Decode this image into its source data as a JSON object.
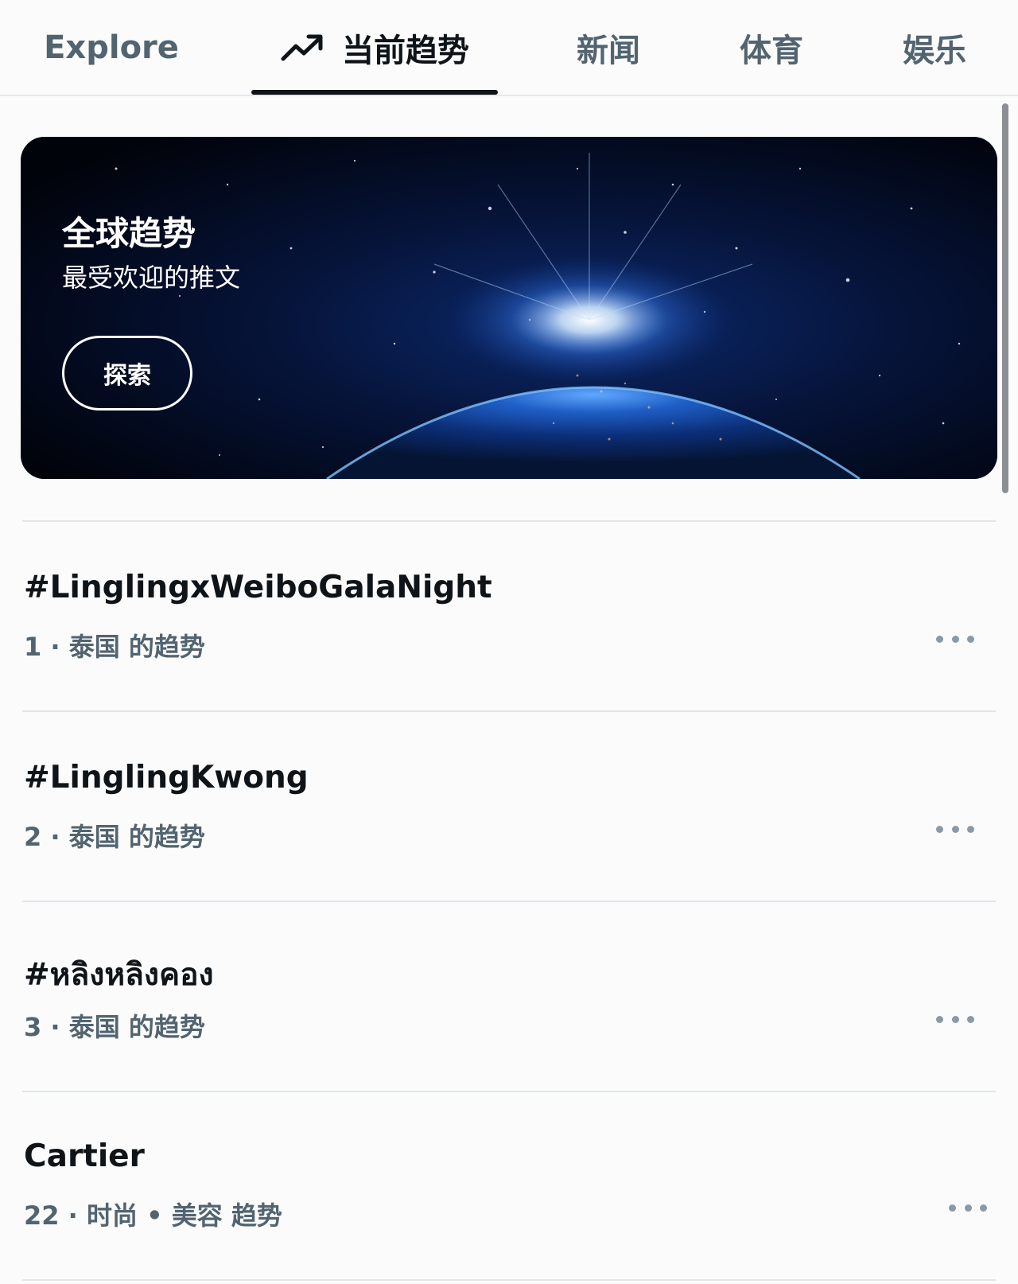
{
  "tabs": [
    {
      "label": "Explore"
    },
    {
      "label": "当前趋势",
      "icon": "trending-up-icon",
      "active": true
    },
    {
      "label": "新闻"
    },
    {
      "label": "体育"
    },
    {
      "label": "娱乐"
    }
  ],
  "hero": {
    "title": "全球趋势",
    "subtitle": "最受欢迎的推文",
    "button_label": "探索"
  },
  "trends": [
    {
      "title": "#LinglingxWeiboGalaNight",
      "meta": "1 · 泰国 的趋势"
    },
    {
      "title": "#LinglingKwong",
      "meta": "2 · 泰国 的趋势"
    },
    {
      "title": "#หลิงหลิงคอง",
      "meta": "3 · 泰国 的趋势"
    },
    {
      "title": "Cartier",
      "meta": "22 · 时尚 • 美容 趋势"
    }
  ],
  "colors": {
    "text_primary": "#0f1419",
    "text_secondary": "#536471",
    "divider": "#e2e6ea",
    "more_dots": "#8b98a5"
  }
}
